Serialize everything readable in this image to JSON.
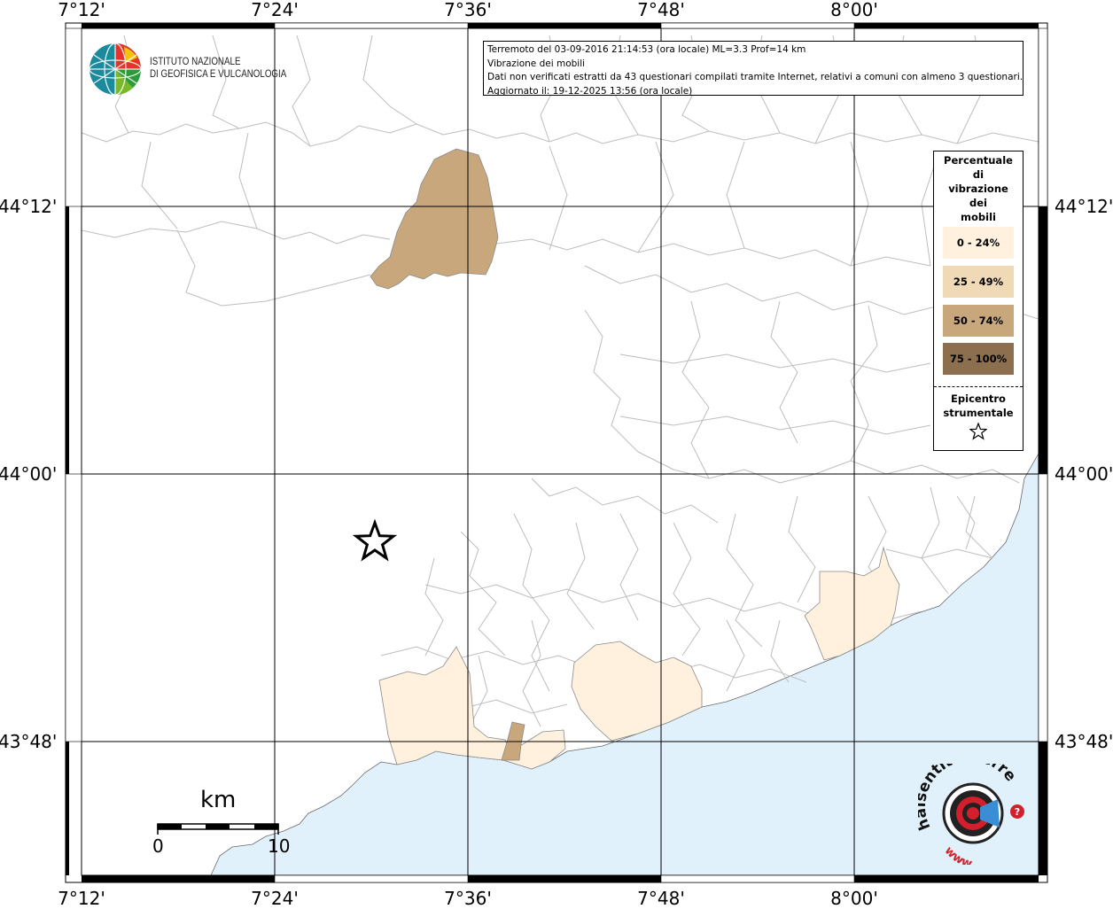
{
  "map": {
    "lon_ticks": [
      "7°12'",
      "7°24'",
      "7°36'",
      "7°48'",
      "8°00'"
    ],
    "lat_ticks": [
      "44°12'",
      "44°00'",
      "43°48'"
    ],
    "colors": {
      "sea": "#e1f1fb",
      "land": "#ffffff",
      "boundary": "#b0b0b0",
      "grid": "#000000",
      "class_0_24": "#fff1de",
      "class_25_49": "#efd9b6",
      "class_50_74": "#c9a77d",
      "class_75_100": "#8b6f4f"
    }
  },
  "info": {
    "line1": "Terremoto del 03-09-2016 21:14:53 (ora locale) ML=3.3 Prof=14 km",
    "line2": "Vibrazione dei mobili",
    "line3": "Dati non verificati estratti da 43 questionari compilati tramite Internet, relativi a comuni con almeno 3 questionari.",
    "line4": "Aggiornato il: 19-12-2025 13:56 (ora locale)"
  },
  "legend": {
    "title_lines": [
      "Percentuale",
      "di",
      "vibrazione",
      "dei",
      "mobili"
    ],
    "classes": [
      {
        "label": "0 - 24%",
        "color": "#fff1de"
      },
      {
        "label": "25 - 49%",
        "color": "#efd9b6"
      },
      {
        "label": "50 - 74%",
        "color": "#c9a77d"
      },
      {
        "label": "75 - 100%",
        "color": "#8b6f4f"
      }
    ],
    "epicenter_lines": [
      "Epicentro",
      "strumentale"
    ],
    "epicenter_icon": "star-outline-icon"
  },
  "scale_bar": {
    "unit": "km",
    "start": "0",
    "end": "10"
  },
  "logos": {
    "ingv_line1": "ISTITUTO NAZIONALE",
    "ingv_line2": "DI GEOFISICA E VULCANOLOGIA",
    "hst_text": "haisentitoilterremoto.it",
    "hst_prefix": "www.",
    "hst_brand_color": "#d31e2b"
  }
}
